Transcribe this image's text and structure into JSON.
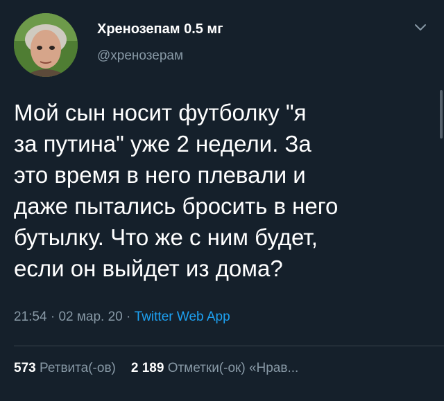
{
  "author": {
    "display_name": "Хренозепам 0.5 мг",
    "handle": "@хренозерам"
  },
  "tweet": {
    "text": "Мой сын носит футболку \"я\nза путина\" уже 2 недели. За\nэто время в него плевали и\nдаже пытались бросить в него\nбутылку. Что же с ним будет,\nесли он выйдет из дома?"
  },
  "meta": {
    "time": "21:54",
    "separator1": " · ",
    "date": "02 мар. 20",
    "separator2": " · ",
    "source": "Twitter Web App"
  },
  "stats": {
    "retweets_count": "573",
    "retweets_label": "Ретвита(-ов)",
    "likes_count": "2 189",
    "likes_label": "Отметки(-ок) «Нрав..."
  },
  "colors": {
    "background": "#15202b",
    "text_primary": "#ffffff",
    "text_secondary": "#8899a6",
    "accent": "#1da1f2",
    "divider": "#38444d"
  },
  "icons": {
    "menu": "chevron-down-icon"
  }
}
